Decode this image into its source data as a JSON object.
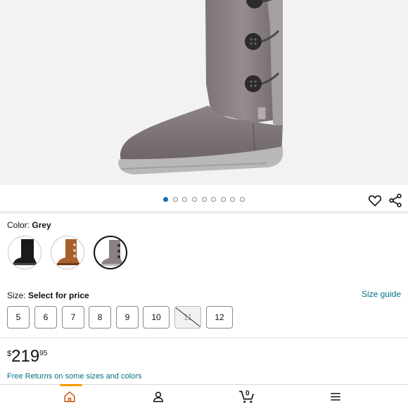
{
  "product": {
    "image_alt": "Grey suede tall boot with buttons",
    "image_count": 9,
    "active_image_index": 0
  },
  "actions": {
    "wishlist_icon": "heart-icon",
    "share_icon": "share-icon"
  },
  "color": {
    "label": "Color:",
    "selected": "Grey",
    "options": [
      {
        "name": "Black",
        "color": "#1a1a1a"
      },
      {
        "name": "Chestnut",
        "color": "#a8602a"
      },
      {
        "name": "Grey",
        "color": "#8a8088"
      }
    ]
  },
  "size": {
    "label": "Size:",
    "prompt": "Select for price",
    "guide_link": "Size guide",
    "options": [
      {
        "label": "5",
        "available": true
      },
      {
        "label": "6",
        "available": true
      },
      {
        "label": "7",
        "available": true
      },
      {
        "label": "8",
        "available": true
      },
      {
        "label": "9",
        "available": true
      },
      {
        "label": "10",
        "available": true
      },
      {
        "label": "11",
        "available": false
      },
      {
        "label": "12",
        "available": true
      }
    ]
  },
  "price": {
    "symbol": "$",
    "whole": "219",
    "fraction": "95"
  },
  "returns_text": "Free Returns on some sizes and colors",
  "bottom_nav": {
    "items": [
      {
        "name": "home",
        "icon": "home-icon",
        "active": true
      },
      {
        "name": "account",
        "icon": "person-icon",
        "active": false
      },
      {
        "name": "cart",
        "icon": "cart-icon",
        "active": false,
        "count": "0"
      },
      {
        "name": "menu",
        "icon": "menu-icon",
        "active": false
      }
    ],
    "accent": "#ff9900"
  }
}
